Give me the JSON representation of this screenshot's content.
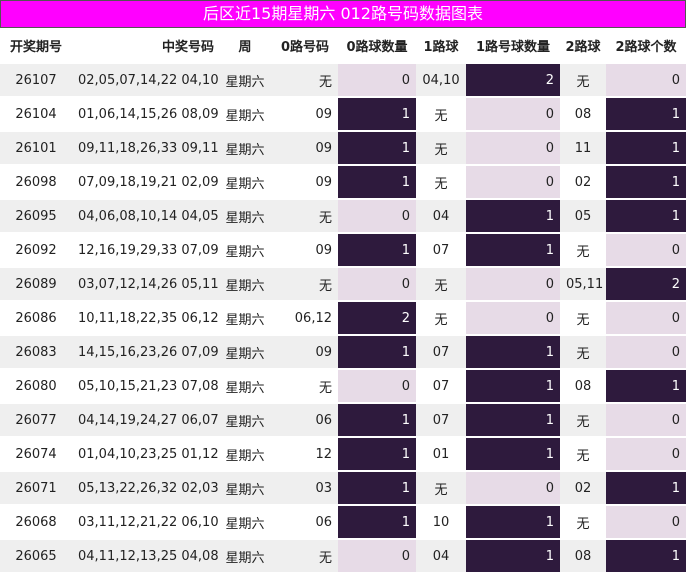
{
  "title": "后区近15期星期六 012路号码数据图表",
  "headers": [
    "开奖期号",
    "中奖号码",
    "周",
    "0路号码",
    "0路球数量",
    "1路球",
    "1路号球数量",
    "2路球",
    "2路球个数"
  ],
  "rows": [
    {
      "issue": "26107",
      "numbers": "02,05,07,14,22 04,10",
      "week": "星期六",
      "r0": "无",
      "r0c": "0",
      "r1": "04,10",
      "r1c": "2",
      "r2": "无",
      "r2c": "0"
    },
    {
      "issue": "26104",
      "numbers": "01,06,14,15,26 08,09",
      "week": "星期六",
      "r0": "09",
      "r0c": "1",
      "r1": "无",
      "r1c": "0",
      "r2": "08",
      "r2c": "1"
    },
    {
      "issue": "26101",
      "numbers": "09,11,18,26,33 09,11",
      "week": "星期六",
      "r0": "09",
      "r0c": "1",
      "r1": "无",
      "r1c": "0",
      "r2": "11",
      "r2c": "1"
    },
    {
      "issue": "26098",
      "numbers": "07,09,18,19,21 02,09",
      "week": "星期六",
      "r0": "09",
      "r0c": "1",
      "r1": "无",
      "r1c": "0",
      "r2": "02",
      "r2c": "1"
    },
    {
      "issue": "26095",
      "numbers": "04,06,08,10,14 04,05",
      "week": "星期六",
      "r0": "无",
      "r0c": "0",
      "r1": "04",
      "r1c": "1",
      "r2": "05",
      "r2c": "1"
    },
    {
      "issue": "26092",
      "numbers": "12,16,19,29,33 07,09",
      "week": "星期六",
      "r0": "09",
      "r0c": "1",
      "r1": "07",
      "r1c": "1",
      "r2": "无",
      "r2c": "0"
    },
    {
      "issue": "26089",
      "numbers": "03,07,12,14,26 05,11",
      "week": "星期六",
      "r0": "无",
      "r0c": "0",
      "r1": "无",
      "r1c": "0",
      "r2": "05,11",
      "r2c": "2"
    },
    {
      "issue": "26086",
      "numbers": "10,11,18,22,35 06,12",
      "week": "星期六",
      "r0": "06,12",
      "r0c": "2",
      "r1": "无",
      "r1c": "0",
      "r2": "无",
      "r2c": "0"
    },
    {
      "issue": "26083",
      "numbers": "14,15,16,23,26 07,09",
      "week": "星期六",
      "r0": "09",
      "r0c": "1",
      "r1": "07",
      "r1c": "1",
      "r2": "无",
      "r2c": "0"
    },
    {
      "issue": "26080",
      "numbers": "05,10,15,21,23 07,08",
      "week": "星期六",
      "r0": "无",
      "r0c": "0",
      "r1": "07",
      "r1c": "1",
      "r2": "08",
      "r2c": "1"
    },
    {
      "issue": "26077",
      "numbers": "04,14,19,24,27 06,07",
      "week": "星期六",
      "r0": "06",
      "r0c": "1",
      "r1": "07",
      "r1c": "1",
      "r2": "无",
      "r2c": "0"
    },
    {
      "issue": "26074",
      "numbers": "01,04,10,23,25 01,12",
      "week": "星期六",
      "r0": "12",
      "r0c": "1",
      "r1": "01",
      "r1c": "1",
      "r2": "无",
      "r2c": "0"
    },
    {
      "issue": "26071",
      "numbers": "05,13,22,26,32 02,03",
      "week": "星期六",
      "r0": "03",
      "r0c": "1",
      "r1": "无",
      "r1c": "0",
      "r2": "02",
      "r2c": "1"
    },
    {
      "issue": "26068",
      "numbers": "03,11,12,21,22 06,10",
      "week": "星期六",
      "r0": "06",
      "r0c": "1",
      "r1": "10",
      "r1c": "1",
      "r2": "无",
      "r2c": "0"
    },
    {
      "issue": "26065",
      "numbers": "04,11,12,13,25 04,08",
      "week": "星期六",
      "r0": "无",
      "r0c": "0",
      "r1": "04",
      "r1c": "1",
      "r2": "08",
      "r2c": "1"
    }
  ]
}
